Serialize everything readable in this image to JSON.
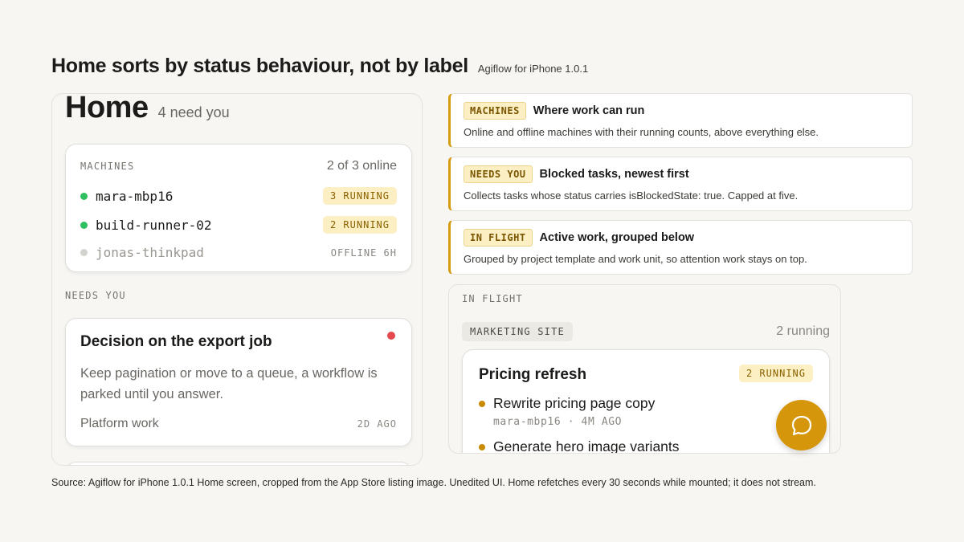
{
  "heading": {
    "title": "Home sorts by status behaviour, not by label",
    "subtitle": "Agiflow for iPhone 1.0.1"
  },
  "phone": {
    "title": "Home",
    "need_count": "4 need you",
    "machines": {
      "label": "MACHINES",
      "online": "2 of 3 online",
      "items": [
        {
          "name": "mara-mbp16",
          "status": "3 RUNNING",
          "online": true
        },
        {
          "name": "build-runner-02",
          "status": "2 RUNNING",
          "online": true
        },
        {
          "name": "jonas-thinkpad",
          "status": "OFFLINE 6H",
          "online": false
        }
      ]
    },
    "needs_you": {
      "label": "NEEDS YOU",
      "card": {
        "title": "Decision on the export job",
        "body": "Keep pagination or move to a queue, a workflow is parked until you answer.",
        "project": "Platform work",
        "age": "2D AGO"
      }
    }
  },
  "notes": [
    {
      "tag": "MACHINES",
      "head": "Where work can run",
      "desc": "Online and offline machines with their running counts, above everything else."
    },
    {
      "tag": "NEEDS YOU",
      "head": "Blocked tasks, newest first",
      "desc": "Collects tasks whose status carries isBlockedState: true. Capped at five."
    },
    {
      "tag": "IN FLIGHT",
      "head": "Active work, grouped below",
      "desc": "Grouped by project template and work unit, so attention work stays on top."
    }
  ],
  "in_flight": {
    "label": "IN FLIGHT",
    "project": "MARKETING SITE",
    "project_count": "2 running",
    "card": {
      "title": "Pricing refresh",
      "status": "2 RUNNING",
      "tasks": [
        {
          "title": "Rewrite pricing page copy",
          "meta": "mara-mbp16 · 4M AGO"
        },
        {
          "title": "Generate hero image variants"
        }
      ]
    }
  },
  "fab": {
    "icon": "chat-bubble-icon"
  },
  "source": "Source: Agiflow for iPhone 1.0.1 Home screen, cropped from the App Store listing image. Unedited UI. Home refetches every 30 seconds while mounted; it does not stream.",
  "colors": {
    "accent": "#d6960c",
    "online": "#2fbf60",
    "offline": "#d4d2cd",
    "blocked": "#e5484d",
    "pill_bg": "#fcefc4"
  }
}
